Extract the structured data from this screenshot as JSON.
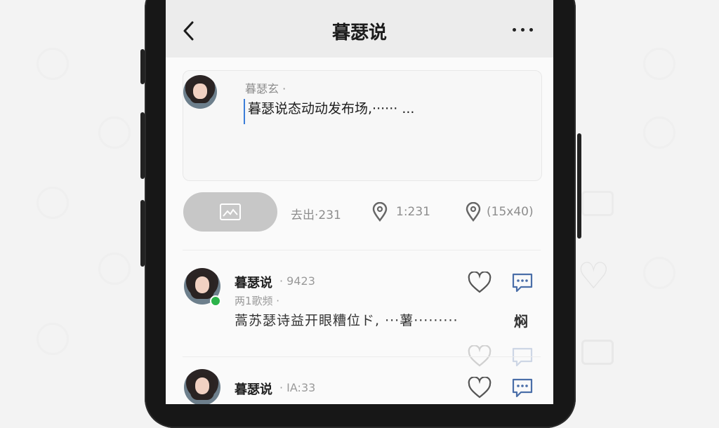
{
  "header": {
    "title": "暮瑟说"
  },
  "composer": {
    "author": "暮瑟玄 ·",
    "text": "暮瑟说态动动发布场,······ ..."
  },
  "toolbar": {
    "location_label": "去出·231",
    "pin1_value": "1:231",
    "pin2_value": "(15x40)"
  },
  "posts": [
    {
      "name": "暮瑟说",
      "count": "· 9423",
      "subtitle": "两1歌频 ·",
      "text": "蒿苏瑟诗益开眼糟位ド, ···薯·········",
      "side_text": "焖",
      "online": true
    },
    {
      "name": "暮瑟说",
      "count": "· ⅠA:33"
    }
  ],
  "colors": {
    "accent_icon": "#4a6ea8",
    "online": "#2bb34a",
    "caret": "#3b7dd8"
  }
}
